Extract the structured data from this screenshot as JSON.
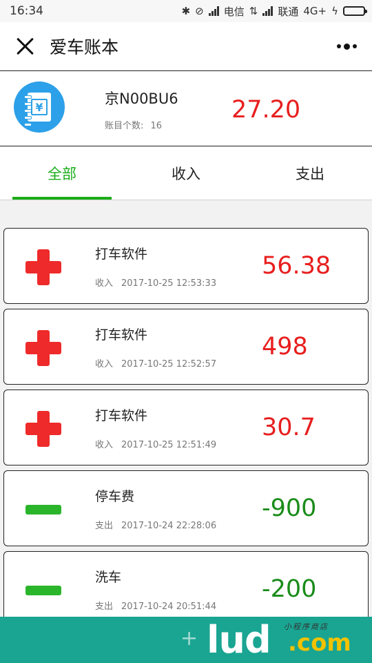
{
  "status_bar": {
    "time": "16:34",
    "carrier1": "电信",
    "carrier2": "联通",
    "network": "4G+"
  },
  "header": {
    "title": "爱车账本"
  },
  "account": {
    "plate": "京N00BU6",
    "count_label": "账目个数:",
    "count_value": "16",
    "total": "27.20"
  },
  "tabs": [
    {
      "label": "全部",
      "active": true
    },
    {
      "label": "收入",
      "active": false
    },
    {
      "label": "支出",
      "active": false
    }
  ],
  "entries": [
    {
      "type": "收入",
      "title": "打车软件",
      "datetime": "2017-10-25 12:53:33",
      "amount": "56.38",
      "sign": "plus-icon"
    },
    {
      "type": "收入",
      "title": "打车软件",
      "datetime": "2017-10-25 12:52:57",
      "amount": "498",
      "sign": "plus-icon"
    },
    {
      "type": "收入",
      "title": "打车软件",
      "datetime": "2017-10-25 12:51:49",
      "amount": "30.7",
      "sign": "plus-icon"
    },
    {
      "type": "支出",
      "title": "停车费",
      "datetime": "2017-10-24 22:28:06",
      "amount": "-900",
      "sign": "minus-icon"
    },
    {
      "type": "支出",
      "title": "洗车",
      "datetime": "2017-10-24 20:51:44",
      "amount": "-200",
      "sign": "minus-icon"
    }
  ],
  "watermark": {
    "text": "lud",
    "domain": ".com",
    "tag": "小程序商店"
  },
  "colors": {
    "accent": "#1aad19",
    "income": "#e81e1e",
    "expense": "#1a8c1a",
    "logo": "#2ca0e8"
  }
}
